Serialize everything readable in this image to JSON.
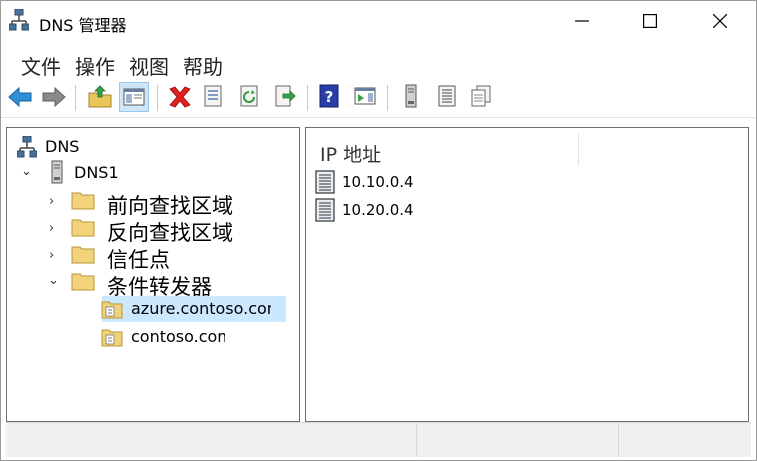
{
  "window": {
    "title": "DNS 管理器"
  },
  "menu": {
    "items": [
      "文件",
      "操作",
      "视图",
      "帮助"
    ]
  },
  "toolbar": {
    "icons": [
      "back-arrow-icon",
      "forward-arrow-icon",
      "up-folder-icon",
      "show-hide-console-tree-icon",
      "delete-icon",
      "properties-icon",
      "refresh-icon",
      "export-list-icon",
      "help-icon",
      "show-action-pane-icon",
      "server-icon",
      "list-icon",
      "copy-icon"
    ]
  },
  "tree": {
    "root": "DNS",
    "server": "DNS1",
    "zones": [
      "前向查找区域",
      "反向查找区域",
      "信任点",
      "条件转发器"
    ],
    "forwarders": [
      "azure.contoso.com",
      "contoso.com"
    ],
    "selected": "azure.contoso.com"
  },
  "list": {
    "column": "IP 地址",
    "rows": [
      "10.10.0.4",
      "10.20.0.4"
    ]
  },
  "colors": {
    "selection": "#cce8ff",
    "toolbar_active": "#cfe6fa",
    "back_arrow": "#2f8fd8",
    "delete": "#e02020",
    "help": "#2a3ea8"
  }
}
